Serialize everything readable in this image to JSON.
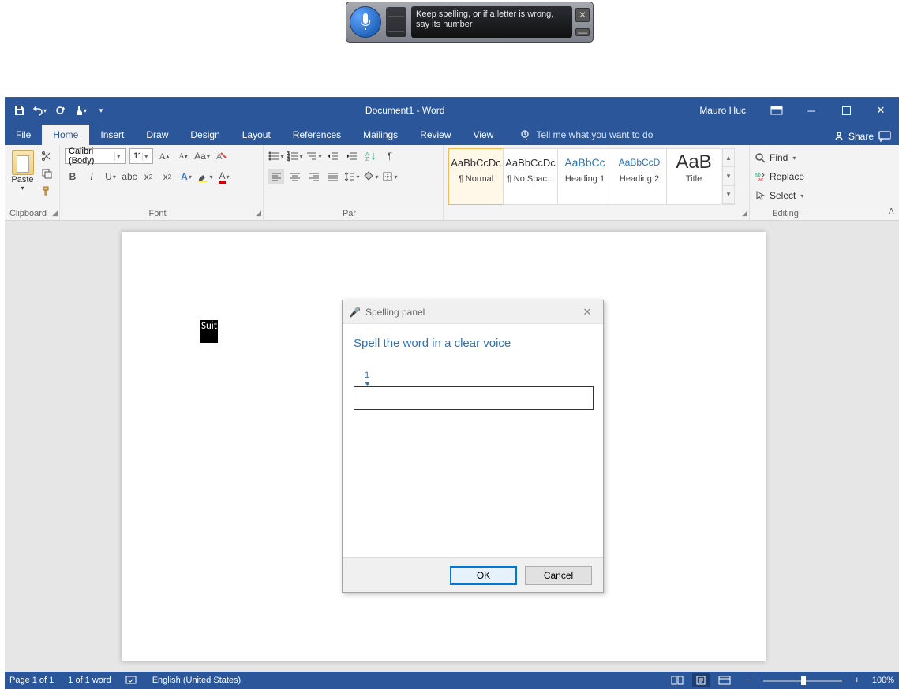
{
  "speech": {
    "text": "Keep spelling, or if a letter is wrong, say its number"
  },
  "titlebar": {
    "title": "Document1  -  Word",
    "user": "Mauro Huc"
  },
  "tabs": {
    "file": "File",
    "home": "Home",
    "insert": "Insert",
    "draw": "Draw",
    "design": "Design",
    "layout": "Layout",
    "references": "References",
    "mailings": "Mailings",
    "review": "Review",
    "view": "View",
    "tellme": "Tell me what you want to do",
    "share": "Share"
  },
  "ribbon": {
    "clipboard": {
      "label": "Clipboard",
      "paste": "Paste"
    },
    "font": {
      "label": "Font",
      "name": "Calibri (Body)",
      "size": "11"
    },
    "paragraph": {
      "label": "Par"
    },
    "styles": {
      "label": "",
      "items": [
        {
          "preview": "AaBbCcDc",
          "label": "¶ Normal"
        },
        {
          "preview": "AaBbCcDc",
          "label": "¶ No Spac..."
        },
        {
          "preview": "AaBbCc",
          "label": "Heading 1"
        },
        {
          "preview": "AaBbCcD",
          "label": "Heading 2"
        },
        {
          "preview": "AaB",
          "label": "Title"
        }
      ]
    },
    "editing": {
      "label": "Editing",
      "find": "Find",
      "replace": "Replace",
      "select": "Select"
    }
  },
  "document": {
    "selected_text": "Suit"
  },
  "dialog": {
    "title": "Spelling panel",
    "heading": "Spell the word in a clear voice",
    "field_number": "1",
    "value": "",
    "ok": "OK",
    "cancel": "Cancel"
  },
  "status": {
    "page": "Page 1 of 1",
    "words": "1 of 1 word",
    "language": "English (United States)",
    "zoom": "100%"
  }
}
